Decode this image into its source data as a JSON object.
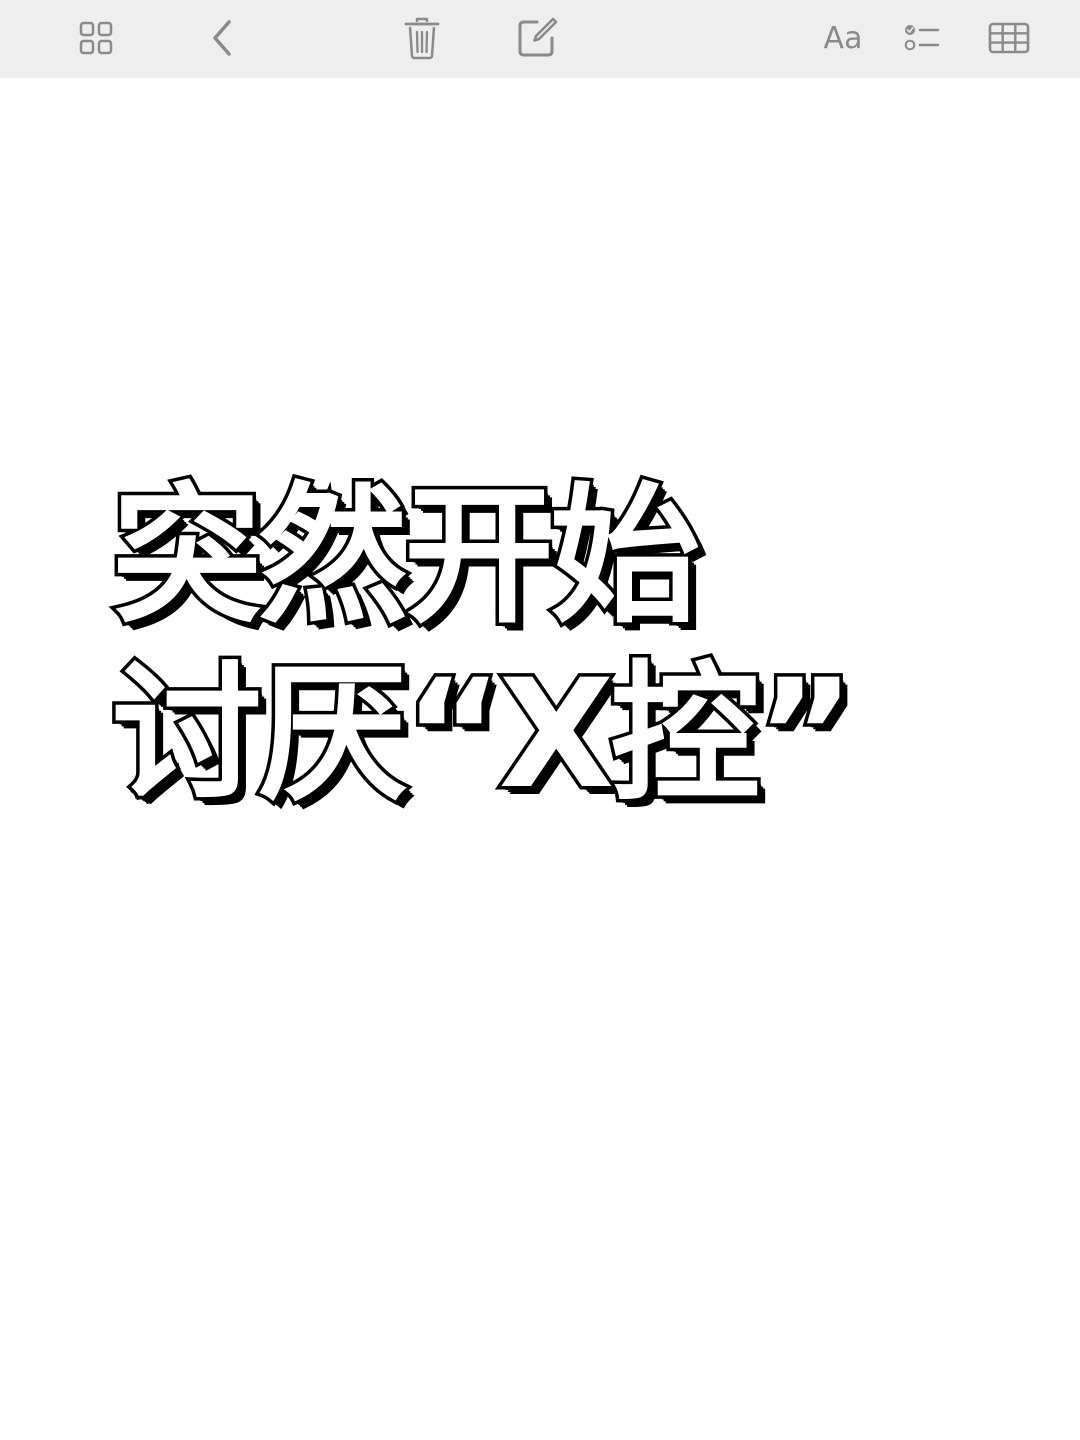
{
  "toolbar": {
    "left_icons": [
      "grid-icon",
      "back-chevron-icon"
    ],
    "center_icons": [
      "trash-icon",
      "compose-icon"
    ],
    "right": {
      "format_label": "Aa",
      "icons": [
        "checklist-icon",
        "table-icon"
      ]
    },
    "background_color": "#eeeeee",
    "icon_color": "#8a8a8a"
  },
  "note": {
    "title_lines": [
      "突然开始",
      "讨厌“X控”"
    ],
    "text_color": "#ffffff",
    "outline_color": "#000000"
  }
}
